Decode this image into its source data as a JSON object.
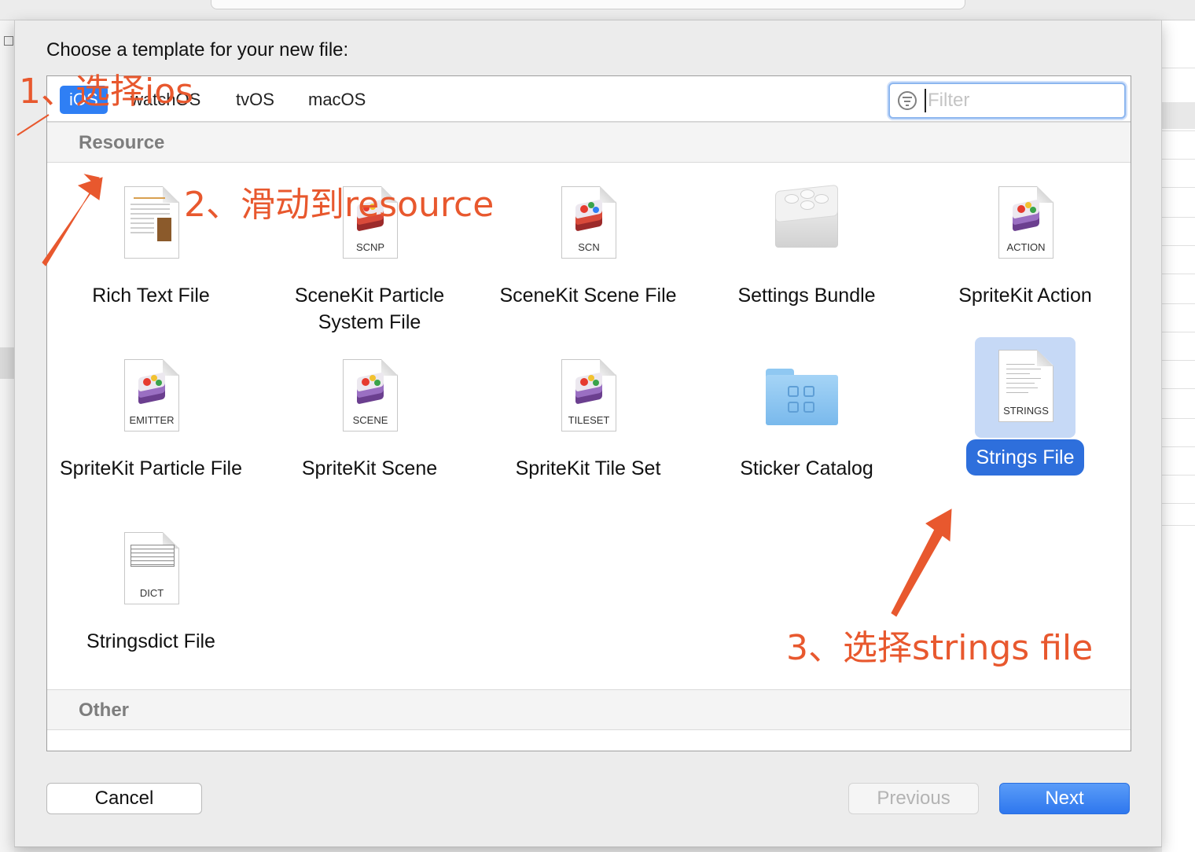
{
  "dialog": {
    "prompt": "Choose a template for your new file:",
    "platform_tabs": [
      "iOS",
      "watchOS",
      "tvOS",
      "macOS"
    ],
    "selected_tab": "iOS",
    "filter_placeholder": "Filter"
  },
  "sections": {
    "resource": "Resource",
    "other": "Other"
  },
  "templates": [
    {
      "name": "Rich Text File",
      "icon": "rich-text-doc-icon",
      "tag": ""
    },
    {
      "name": "SceneKit Particle System File",
      "icon": "scenekit-particle-icon",
      "tag": "SCNP"
    },
    {
      "name": "SceneKit Scene File",
      "icon": "scenekit-scene-icon",
      "tag": "SCN"
    },
    {
      "name": "Settings Bundle",
      "icon": "settings-bundle-icon",
      "tag": ""
    },
    {
      "name": "SpriteKit Action",
      "icon": "spritekit-action-icon",
      "tag": "ACTION"
    },
    {
      "name": "SpriteKit Particle File",
      "icon": "spritekit-emitter-icon",
      "tag": "EMITTER"
    },
    {
      "name": "SpriteKit Scene",
      "icon": "spritekit-scene-icon",
      "tag": "SCENE"
    },
    {
      "name": "SpriteKit Tile Set",
      "icon": "spritekit-tileset-icon",
      "tag": "TILESET"
    },
    {
      "name": "Sticker Catalog",
      "icon": "folder-icon",
      "tag": ""
    },
    {
      "name": "Strings File",
      "icon": "strings-doc-icon",
      "tag": "STRINGS",
      "selected": true
    },
    {
      "name": "Stringsdict File",
      "icon": "dict-doc-icon",
      "tag": "DICT"
    }
  ],
  "buttons": {
    "cancel": "Cancel",
    "previous": "Previous",
    "next": "Next"
  },
  "annotations": {
    "step1": "1、选择ios",
    "step2": "2、滑动到resource",
    "step3": "3、选择strings file",
    "color": "#e8582e"
  },
  "colors": {
    "accent": "#2f7ff4",
    "selection_highlight": "#c6d9f6",
    "selected_label": "#2e6fdc"
  }
}
